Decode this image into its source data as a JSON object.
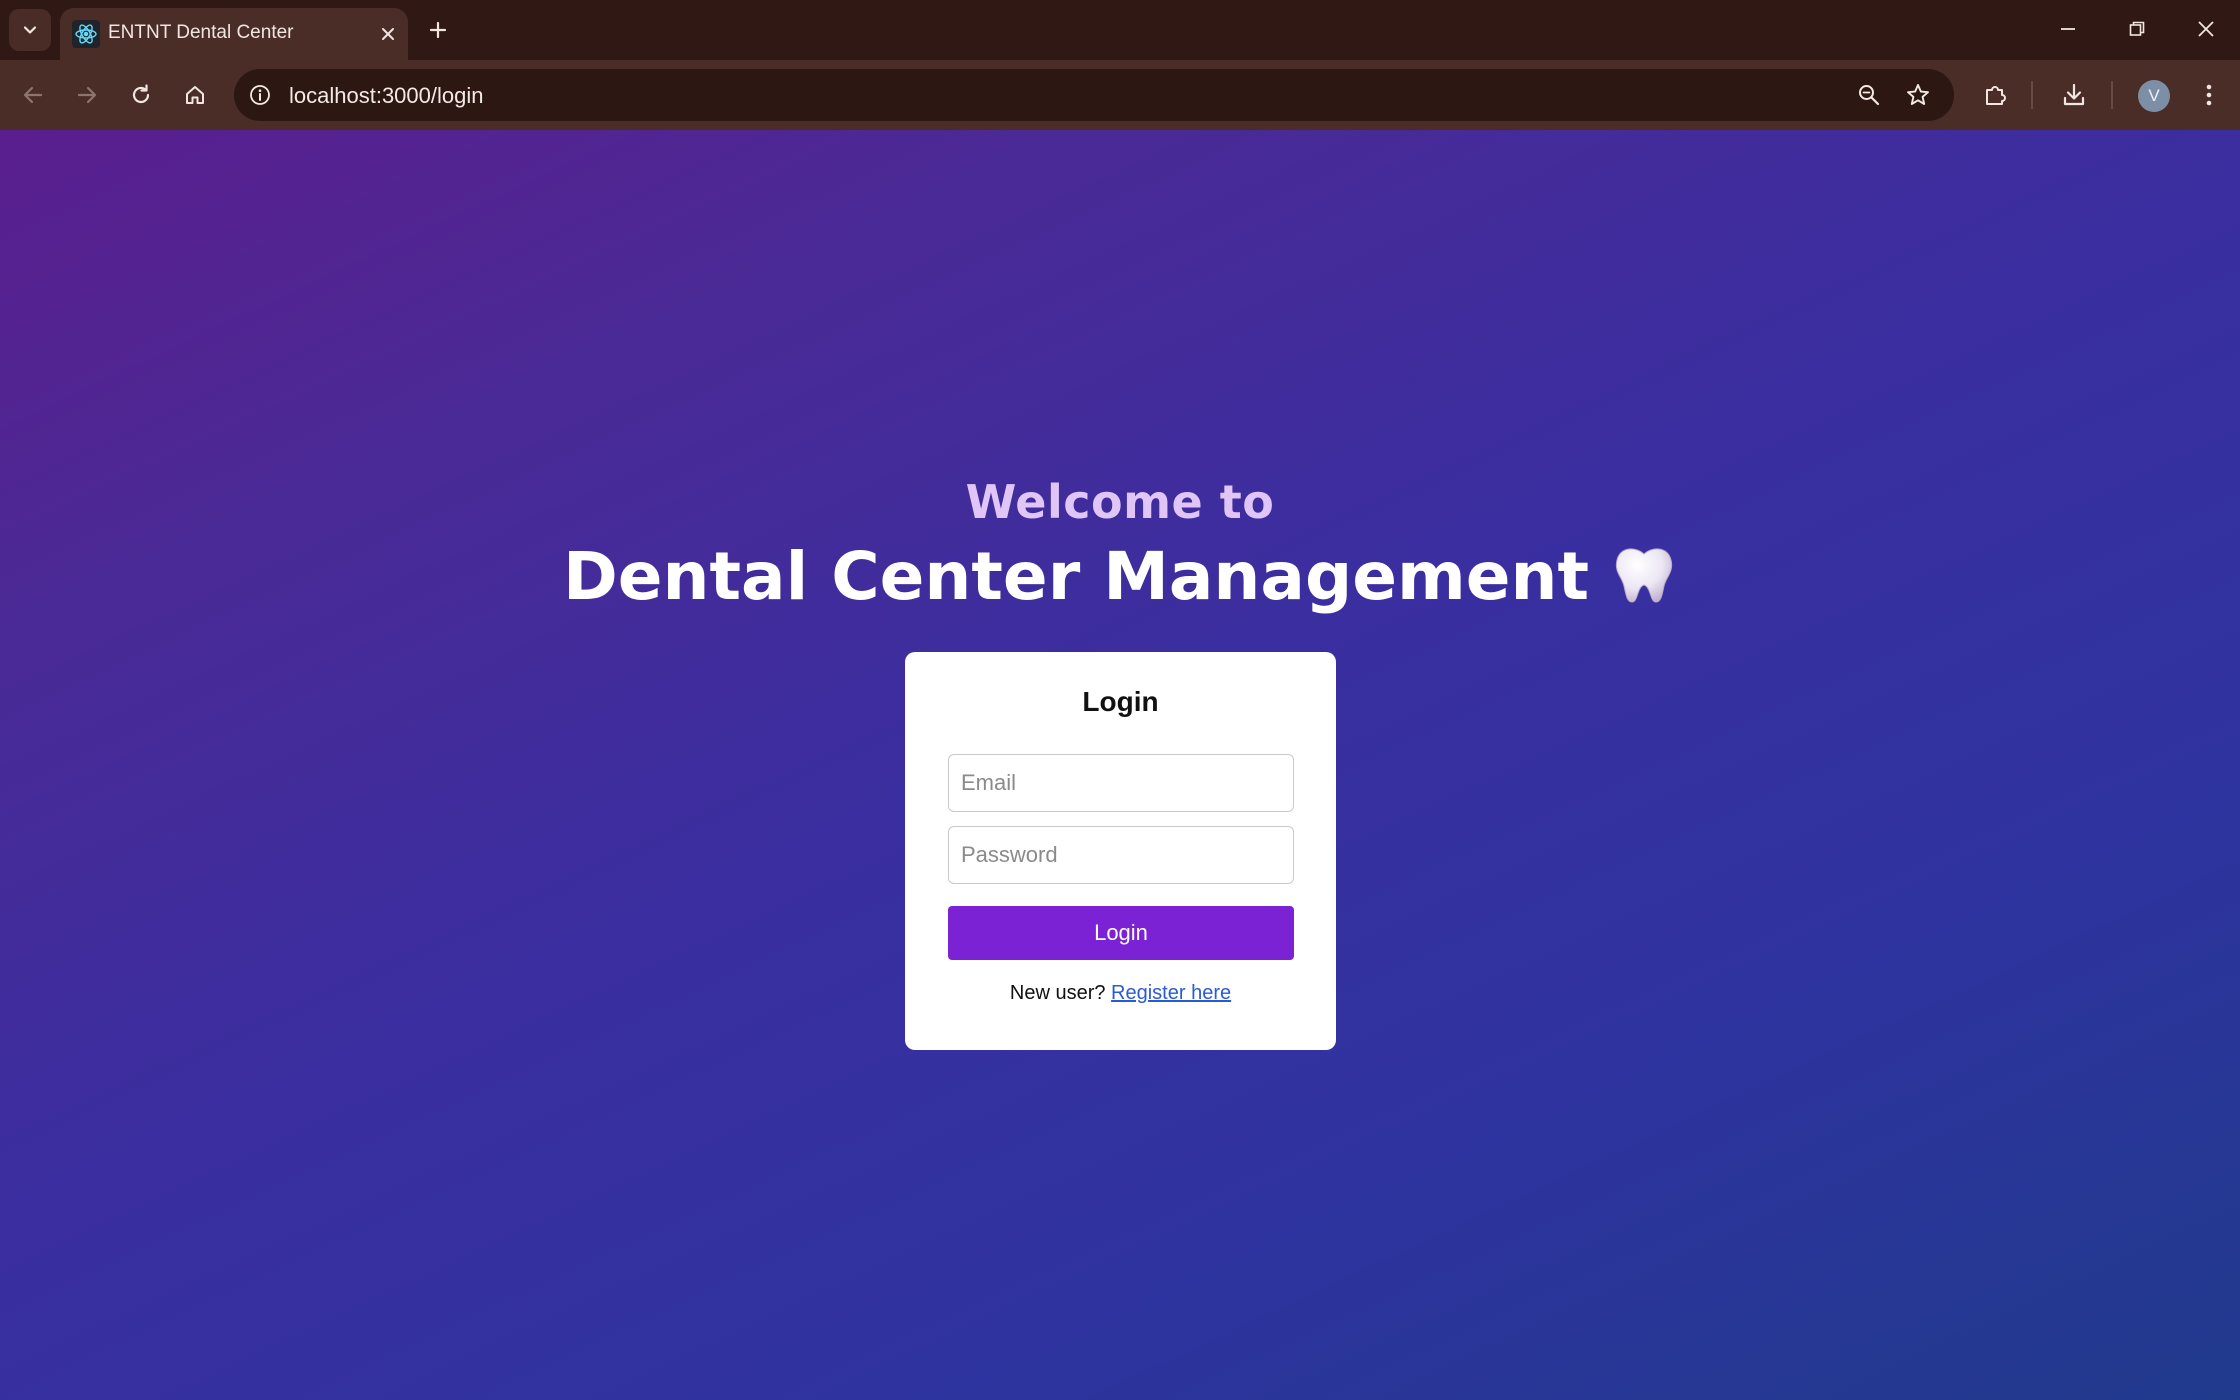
{
  "browser": {
    "tab": {
      "title": "ENTNT Dental Center"
    },
    "address_bar": {
      "url": "localhost:3000/login"
    },
    "profile_initial": "V",
    "colors": {
      "frame": "#301915",
      "toolbar": "#4b2d27",
      "omnibox": "#2c1713"
    }
  },
  "page": {
    "welcome_text": "Welcome to",
    "headline": "Dental Center Management",
    "headline_emoji": "tooth",
    "gradient_colors": [
      "#5a1e8e",
      "#3a2ea0",
      "#203a8c"
    ]
  },
  "login_card": {
    "title": "Login",
    "email": {
      "placeholder": "Email",
      "value": ""
    },
    "password": {
      "placeholder": "Password",
      "value": ""
    },
    "submit_label": "Login",
    "submit_color": "#7b22d4",
    "new_user_text": "New user?",
    "register_link": "Register here"
  }
}
